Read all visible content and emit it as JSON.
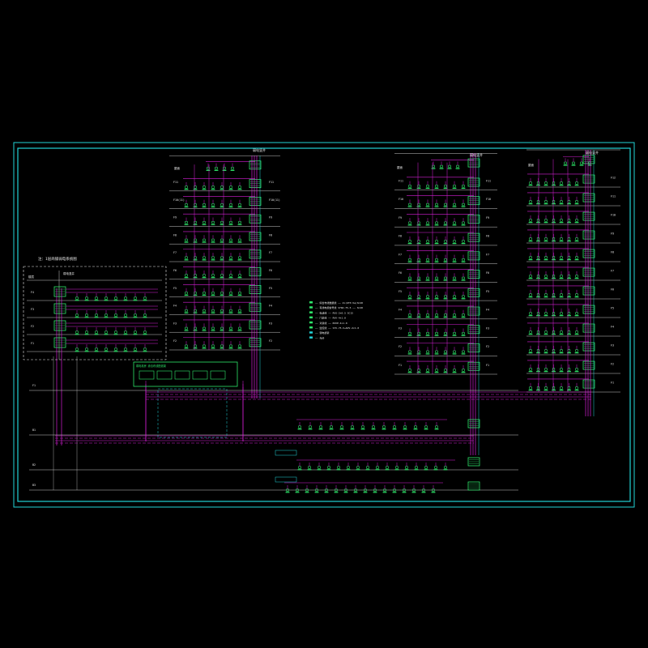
{
  "drawing": {
    "colors": {
      "background": "#000000",
      "frame": "#22d3d6",
      "wire": "#d61fd6",
      "device": "#2ee86a",
      "floor_line": "#c8c8c8",
      "label": "#e8e8e8",
      "riser_box": "#2ee86a"
    },
    "towers": [
      {
        "id": "left-tower",
        "header": "弱电竖井",
        "top_label": "屋面"
      },
      {
        "id": "middle-tower",
        "header": "弱电竖井",
        "top_label": "屋面"
      },
      {
        "id": "right-tower",
        "header": "弱电竖井",
        "top_label": "屋面"
      }
    ],
    "left_tower_floor_labels": [
      "F11",
      "F10(11)",
      "F9",
      "F8",
      "F7",
      "F6",
      "F5",
      "F4",
      "F3",
      "F2"
    ],
    "middle_tower_floor_labels": [
      "F11",
      "F10",
      "F9",
      "F8",
      "F7",
      "F6",
      "F5",
      "F4",
      "F3",
      "F2",
      "F1"
    ],
    "right_tower_floor_labels": [
      "F12",
      "F11",
      "F10",
      "F9",
      "F8",
      "F7",
      "F6",
      "F5",
      "F4",
      "F3",
      "F2",
      "F1"
    ],
    "podium": {
      "title": "注：1层商铺弱电系统图",
      "header_left": "楼层",
      "header_right": "弱电竖井",
      "floor_labels": [
        "F4",
        "F3",
        "F2",
        "F1"
      ]
    },
    "base_floor_labels": [
      "F1",
      "B1",
      "B2",
      "B3"
    ],
    "center_box_title": "弱电机房 综合布线配线架",
    "legend": [
      "—— 综合布线数据线 —— 2×(UTP-5e)SC20",
      "—— 有线电视信号线 SYWV-75-5 —— SC20",
      "—— 电话线 —— RVS-2×0.5 SC15",
      "—— 门禁线 —— RVV-4×1.0",
      "—— 对讲线 —— RVVP-4×1.0",
      "—— 监控线 —— SYV-75-5+RVV-2×1.0",
      "—— 弱电桥架",
      "—— 光纤"
    ],
    "shaft_note": "弱电井"
  }
}
